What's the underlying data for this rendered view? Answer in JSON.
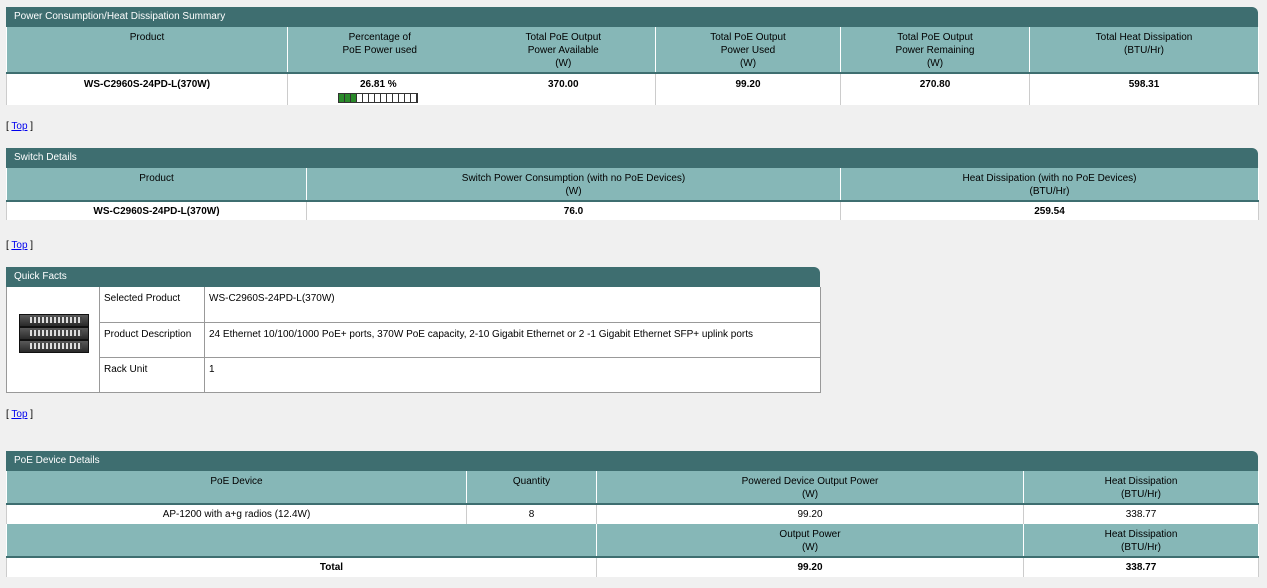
{
  "power_summary": {
    "title": "Power Consumption/Heat Dissipation Summary",
    "headers": {
      "product": "Product",
      "pct_line1": "Percentage of",
      "pct_line2": "PoE Power used",
      "avail_line1": "Total PoE Output",
      "avail_line2": "Power Available",
      "avail_unit": "(W)",
      "used_line1": "Total PoE Output",
      "used_line2": "Power Used",
      "used_unit": "(W)",
      "remain_line1": "Total PoE Output",
      "remain_line2": "Power Remaining",
      "remain_unit": "(W)",
      "heat_line1": "Total Heat Dissipation",
      "heat_unit": "(BTU/Hr)"
    },
    "row": {
      "product": "WS-C2960S-24PD-L(370W)",
      "percentage": "26.81 %",
      "gauge_fraction": 0.2681,
      "available": "370.00",
      "used": "99.20",
      "remaining": "270.80",
      "heat": "598.31"
    }
  },
  "top_link": {
    "open": "[ ",
    "label": "Top",
    "close": " ]"
  },
  "switch_details": {
    "title": "Switch Details",
    "headers": {
      "product": "Product",
      "consumption": "Switch Power Consumption (with no PoE Devices)",
      "consumption_unit": "(W)",
      "heat": "Heat Dissipation (with no PoE Devices)",
      "heat_unit": "(BTU/Hr)"
    },
    "row": {
      "product": "WS-C2960S-24PD-L(370W)",
      "consumption": "76.0",
      "heat": "259.54"
    }
  },
  "quick_facts": {
    "title": "Quick Facts",
    "rows": [
      {
        "label": "Selected Product",
        "value": "WS-C2960S-24PD-L(370W)"
      },
      {
        "label": "Product Description",
        "value": "24 Ethernet 10/100/1000 PoE+ ports, 370W PoE capacity, 2-10 Gigabit Ethernet or 2 -1 Gigabit Ethernet SFP+ uplink ports"
      },
      {
        "label": "Rack Unit",
        "value": "1"
      }
    ]
  },
  "poe_details": {
    "title": "PoE Device Details",
    "headers": {
      "device": "PoE Device",
      "quantity": "Quantity",
      "output_line1": "Powered Device Output Power",
      "output_unit": "(W)",
      "heat_line1": "Heat Dissipation",
      "heat_unit": "(BTU/Hr)"
    },
    "row": {
      "device": "AP-1200 with a+g radios (12.4W)",
      "quantity": "8",
      "output": "99.20",
      "heat": "338.77"
    },
    "total_headers": {
      "output_line1": "Output Power",
      "output_unit": "(W)",
      "heat_line1": "Heat Dissipation",
      "heat_unit": "(BTU/Hr)"
    },
    "total_row": {
      "label": "Total",
      "output": "99.20",
      "heat": "338.77"
    }
  }
}
